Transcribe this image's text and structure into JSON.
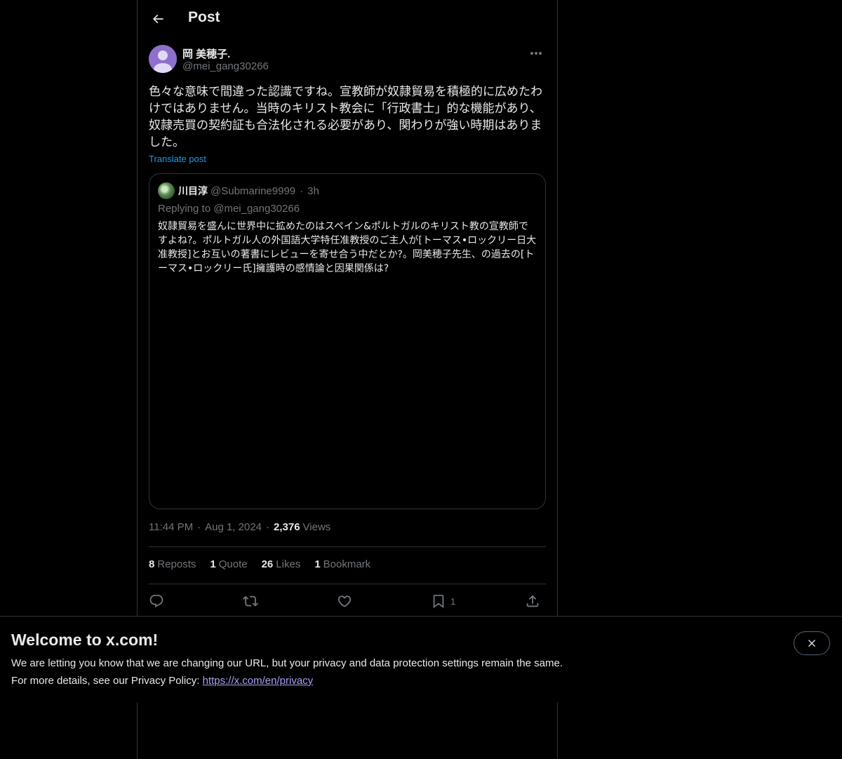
{
  "header": {
    "title": "Post"
  },
  "post": {
    "author_name": "岡 美穂子.",
    "author_handle": "@mei_gang30266",
    "text": "色々な意味で間違った認識ですね。宣教師が奴隷貿易を積極的に広めたわけではありません。当時のキリスト教会に「行政書士」的な機能があり、奴隷売買の契約証も合法化される必要があり、関わりが強い時期はありました。",
    "translate_label": "Translate post",
    "time": "11:44 PM",
    "date": "Aug 1, 2024",
    "views_count": "2,376",
    "views_label": "Views"
  },
  "quote": {
    "name": "川目淳",
    "handle": "@Submarine9999",
    "time": "3h",
    "replying_prefix": "Replying to",
    "replying_to": "@mei_gang30266",
    "text": "奴隷貿易を盛んに世界中に拡めたのはスペイン&ポルトガルのキリスト教の宣教師ですよね?。ポルトガル人の外国語大学特任准教授のご主人が[トーマス•ロックリー日大准教授]とお互いの著書にレビューを寄せ合う中だとか?。岡美穂子先生、の過去の[トーマス•ロックリー氏]擁護時の感情論と因果関係は?"
  },
  "stats": {
    "reposts_count": "8",
    "reposts_label": "Reposts",
    "quotes_count": "1",
    "quotes_label": "Quote",
    "likes_count": "26",
    "likes_label": "Likes",
    "bookmarks_count": "1",
    "bookmarks_label": "Bookmark"
  },
  "actions": {
    "icons": [
      "reply-icon",
      "repost-icon",
      "like-icon",
      "bookmark-icon",
      "share-icon"
    ],
    "bookmark_count": "1"
  },
  "banner": {
    "title": "Welcome to x.com!",
    "line1": "We are letting you know that we are changing our URL, but your privacy and data protection settings remain the same.",
    "line2_prefix": "For more details, see our Privacy Policy:",
    "link": "https://x.com/en/privacy"
  },
  "colors": {
    "background": "#000000",
    "text": "#e7e9ea",
    "muted": "#71767b",
    "accent": "#1d9bf0",
    "avatar": "#8e6fce",
    "link": "#a5a2f5"
  }
}
